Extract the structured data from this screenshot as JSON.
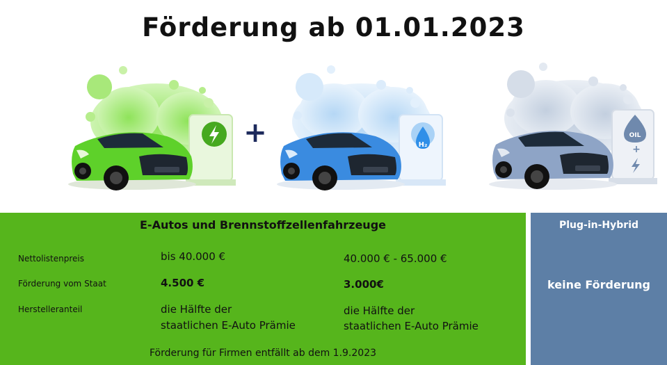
{
  "title": "Förderung ab 01.01.2023",
  "plus_sign": "+",
  "pump_badges": {
    "hydrogen": "H₂",
    "oil": "OIL",
    "hybrid_plus": "+"
  },
  "colors": {
    "green_panel": "#56b51c",
    "blue_panel": "#5d7fa6",
    "green_car": "#5ed12a",
    "blue_car": "#3a8be0",
    "grey_car": "#8ea4c6"
  },
  "ev_section": {
    "heading": "E-Autos und Brennstoffzellenfahrzeuge",
    "rows": [
      {
        "label": "Nettolistenpreis",
        "col1": "bis 40.000 €",
        "col2": "40.000 € - 65.000 €"
      },
      {
        "label": "Förderung vom Staat",
        "col1": "4.500 €",
        "col2": "3.000€"
      },
      {
        "label": "Herstelleranteil",
        "col1_line1": "die Hälfte der",
        "col1_line2": "staatlichen E-Auto Prämie",
        "col2_line1": "die Hälfte der",
        "col2_line2": "staatlichen E-Auto Prämie"
      }
    ],
    "footer": "Förderung für Firmen entfällt ab dem 1.9.2023"
  },
  "phev_section": {
    "heading": "Plug-in-Hybrid",
    "value": "keine Förderung"
  }
}
